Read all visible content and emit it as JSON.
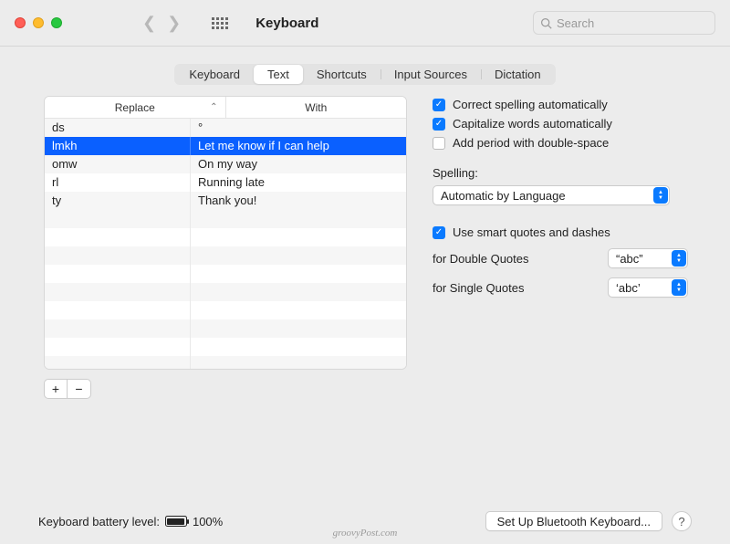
{
  "window": {
    "title": "Keyboard"
  },
  "search": {
    "placeholder": "Search"
  },
  "tabs": [
    "Keyboard",
    "Text",
    "Shortcuts",
    "Input Sources",
    "Dictation"
  ],
  "active_tab": 1,
  "table": {
    "headers": {
      "replace": "Replace",
      "with": "With"
    },
    "rows": [
      {
        "replace": "ds",
        "with": "°",
        "selected": false
      },
      {
        "replace": "lmkh",
        "with": "Let me know if I can help",
        "selected": true
      },
      {
        "replace": "omw",
        "with": "On my way",
        "selected": false
      },
      {
        "replace": "rl",
        "with": "Running late",
        "selected": false
      },
      {
        "replace": "ty",
        "with": "Thank you!",
        "selected": false
      }
    ],
    "add_label": "+",
    "remove_label": "−"
  },
  "options": {
    "correct_spelling": {
      "label": "Correct spelling automatically",
      "checked": true
    },
    "capitalize": {
      "label": "Capitalize words automatically",
      "checked": true
    },
    "add_period": {
      "label": "Add period with double-space",
      "checked": false
    },
    "spelling_label": "Spelling:",
    "spelling_value": "Automatic by Language",
    "smart_quotes": {
      "label": "Use smart quotes and dashes",
      "checked": true
    },
    "double_quotes": {
      "label": "for Double Quotes",
      "value": "“abc”"
    },
    "single_quotes": {
      "label": "for Single Quotes",
      "value": "‘abc’"
    }
  },
  "footer": {
    "battery_label": "Keyboard battery level:",
    "battery_pct": "100%",
    "bluetooth_btn": "Set Up Bluetooth Keyboard...",
    "help": "?"
  },
  "watermark": "groovyPost.com"
}
